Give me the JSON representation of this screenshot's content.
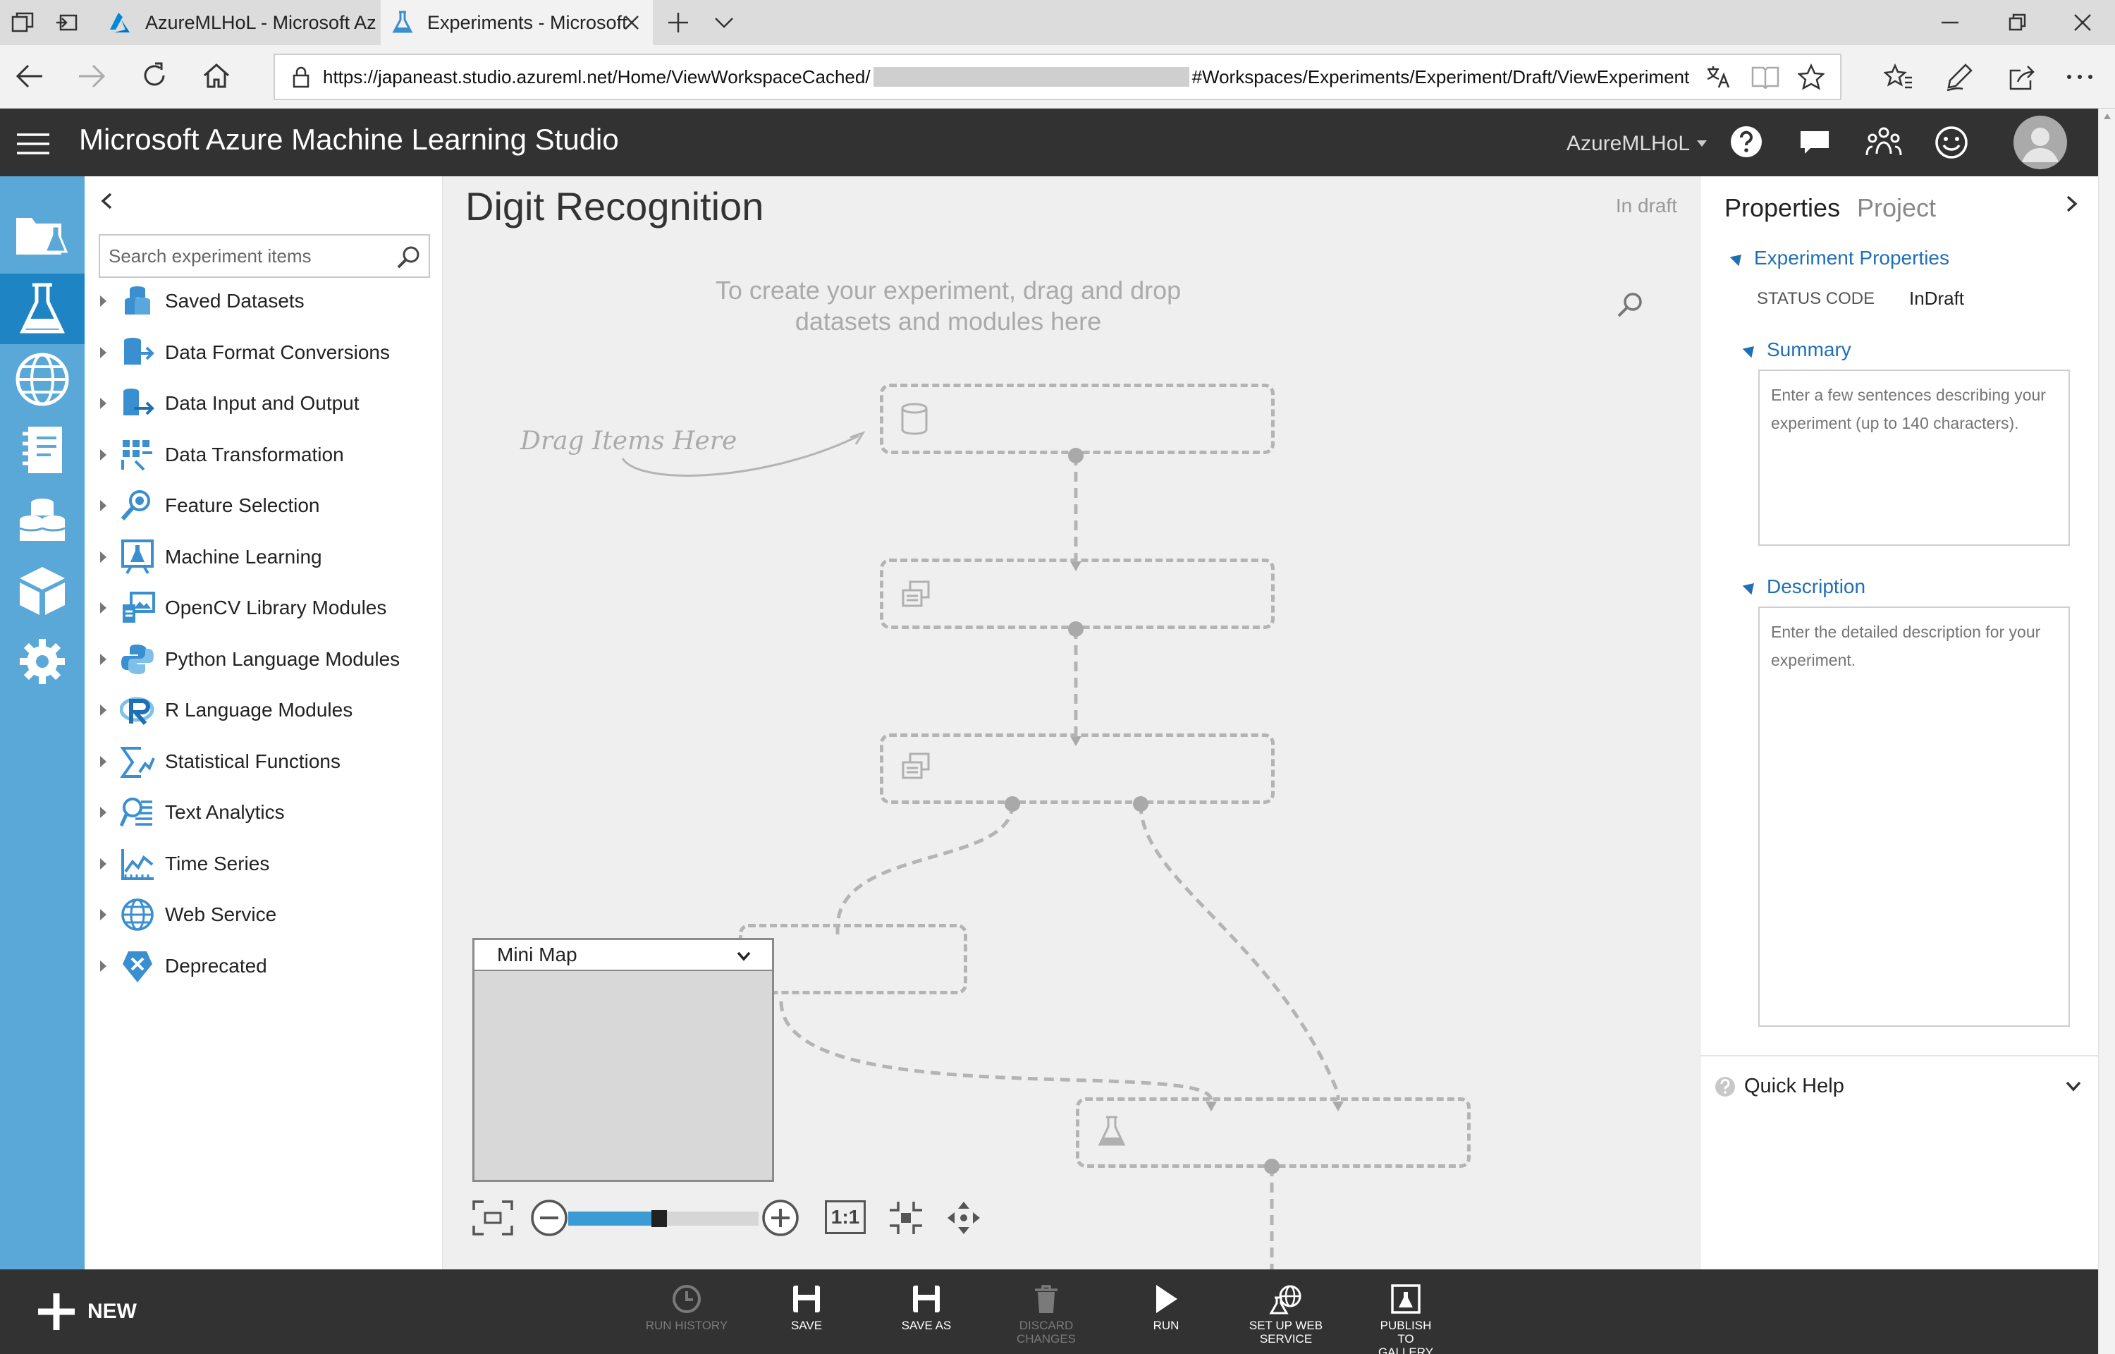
{
  "browser": {
    "tabs": [
      {
        "title": "AzureMLHoL - Microsoft Az"
      },
      {
        "title": "Experiments - Microsoft"
      }
    ],
    "url_prefix": "https://japaneast.studio.azureml.net/Home/ViewWorkspaceCached/",
    "url_suffix": "#Workspaces/Experiments/Experiment/Draft/ViewExperiment"
  },
  "app": {
    "title": "Microsoft Azure Machine Learning Studio",
    "workspace": "AzureMLHoL"
  },
  "palette": {
    "search_placeholder": "Search experiment items",
    "items": [
      {
        "label": "Saved Datasets",
        "icon": "datasets-icon"
      },
      {
        "label": "Data Format Conversions",
        "icon": "data-format-icon"
      },
      {
        "label": "Data Input and Output",
        "icon": "data-io-icon"
      },
      {
        "label": "Data Transformation",
        "icon": "data-transform-icon"
      },
      {
        "label": "Feature Selection",
        "icon": "feature-selection-icon"
      },
      {
        "label": "Machine Learning",
        "icon": "machine-learning-icon"
      },
      {
        "label": "OpenCV Library Modules",
        "icon": "opencv-icon"
      },
      {
        "label": "Python Language Modules",
        "icon": "python-icon"
      },
      {
        "label": "R Language Modules",
        "icon": "r-language-icon"
      },
      {
        "label": "Statistical Functions",
        "icon": "statistical-icon"
      },
      {
        "label": "Text Analytics",
        "icon": "text-analytics-icon"
      },
      {
        "label": "Time Series",
        "icon": "time-series-icon"
      },
      {
        "label": "Web Service",
        "icon": "web-service-icon"
      },
      {
        "label": "Deprecated",
        "icon": "deprecated-icon"
      }
    ]
  },
  "canvas": {
    "experiment_title": "Digit Recognition",
    "status": "In draft",
    "drop_hint": "To create your experiment, drag and drop datasets and modules here",
    "drag_hint": "Drag Items Here",
    "minimap_label": "Mini Map",
    "zoom_reset_label": "1:1",
    "zoom_fraction": 0.45
  },
  "properties": {
    "tab_properties": "Properties",
    "tab_project": "Project",
    "experiment_properties_label": "Experiment Properties",
    "status_code_label": "STATUS CODE",
    "status_code_value": "InDraft",
    "summary_label": "Summary",
    "summary_placeholder": "Enter a few sentences describing your experiment (up to 140 characters).",
    "description_label": "Description",
    "description_placeholder": "Enter the detailed description for your experiment.",
    "quick_help_label": "Quick Help"
  },
  "bottombar": {
    "new_label": "NEW",
    "commands": [
      {
        "label": "RUN HISTORY",
        "enabled": false
      },
      {
        "label": "SAVE",
        "enabled": true
      },
      {
        "label": "SAVE AS",
        "enabled": true
      },
      {
        "label": "DISCARD CHANGES",
        "enabled": false
      },
      {
        "label": "RUN",
        "enabled": true
      },
      {
        "label": "SET UP WEB SERVICE",
        "enabled": true
      },
      {
        "label": "PUBLISH TO GALLERY",
        "enabled": true
      }
    ]
  },
  "colors": {
    "rail_blue": "#59a8d7",
    "header_dark": "#323232",
    "accent_blue": "#1f6fb6",
    "zoom_fill": "#3a9bd5"
  }
}
